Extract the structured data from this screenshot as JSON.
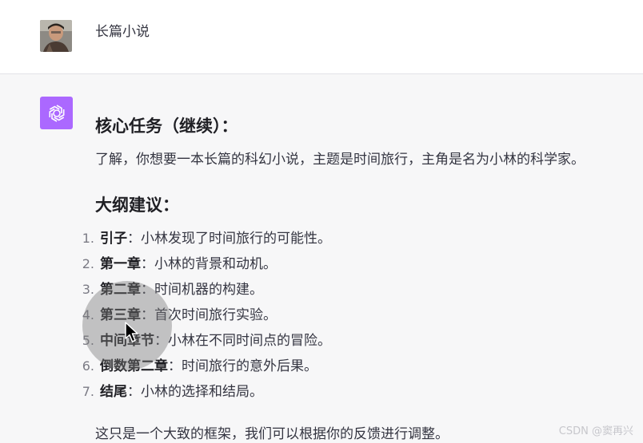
{
  "user_message": {
    "text": "长篇小说"
  },
  "assistant": {
    "heading_core": "核心任务（继续）：",
    "intro": "了解，你想要一本长篇的科幻小说，主题是时间旅行，主角是名为小林的科学家。",
    "heading_outline": "大纲建议：",
    "outline": [
      {
        "num": "1.",
        "term": "引子",
        "sep": "：",
        "desc": "小林发现了时间旅行的可能性。"
      },
      {
        "num": "2.",
        "term": "第一章",
        "sep": "：",
        "desc": "小林的背景和动机。"
      },
      {
        "num": "3.",
        "term": "第二章",
        "sep": "：",
        "desc": "时间机器的构建。"
      },
      {
        "num": "4.",
        "term": "第三章",
        "sep": "：",
        "desc": "首次时间旅行实验。"
      },
      {
        "num": "5.",
        "term": "中间章节",
        "sep": "：",
        "desc": "小林在不同时间点的冒险。"
      },
      {
        "num": "6.",
        "term": "倒数第二章",
        "sep": "：",
        "desc": "时间旅行的意外后果。"
      },
      {
        "num": "7.",
        "term": "结尾",
        "sep": "：",
        "desc": "小林的选择和结局。"
      }
    ],
    "closing": "这只是一个大致的框架，我们可以根据你的反馈进行调整。"
  },
  "watermark": "CSDN @窦再兴",
  "colors": {
    "assistant_avatar": "#ab68ff",
    "user_bg": "#ffffff",
    "assistant_bg": "#f7f7f8"
  }
}
